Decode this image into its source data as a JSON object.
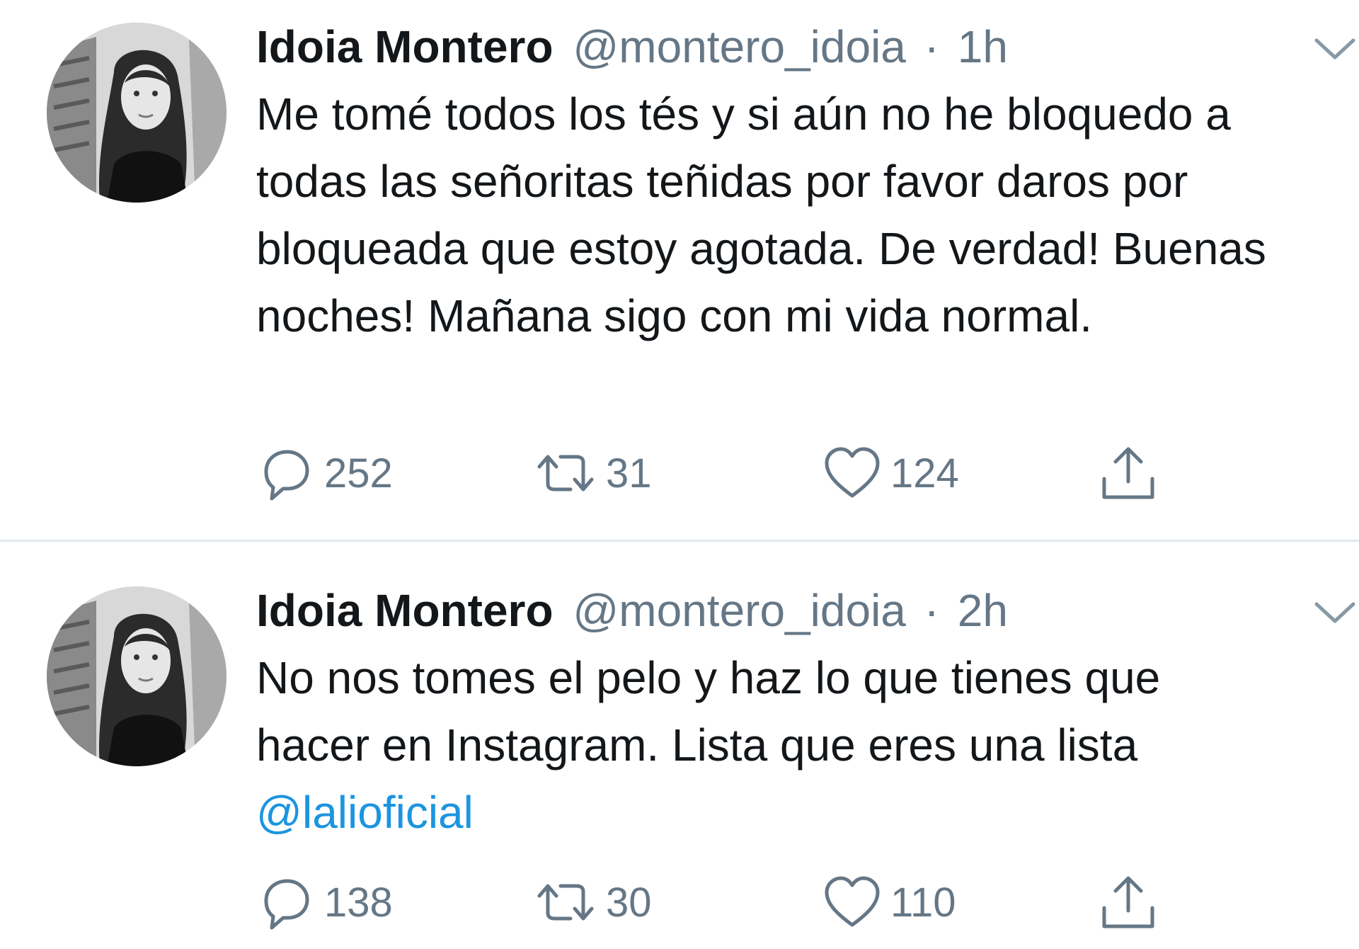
{
  "colors": {
    "text": "#14171a",
    "secondary": "#657786",
    "link": "#1b95e0",
    "divider": "#e1e8ed"
  },
  "tweets": [
    {
      "display_name": "Idoia Montero",
      "handle": "@montero_idoia",
      "separator": "·",
      "time": "1h",
      "text": "Me tomé todos los tés y si aún no he bloquedo a todas las señoritas teñidas por favor daros por bloqueada que estoy agotada. De verdad! Buenas noches! Mañana sigo con mi vida normal.",
      "mention": "",
      "replies": "252",
      "retweets": "31",
      "likes": "124",
      "icons": [
        "avatar",
        "chevron-down-icon",
        "reply-icon",
        "retweet-icon",
        "heart-icon",
        "share-icon"
      ]
    },
    {
      "display_name": "Idoia Montero",
      "handle": "@montero_idoia",
      "separator": "·",
      "time": "2h",
      "text": "No nos tomes el pelo y haz lo que tienes que hacer en Instagram. Lista que eres una lista ",
      "mention": "@lalioficial",
      "replies": "138",
      "retweets": "30",
      "likes": "110",
      "icons": [
        "avatar",
        "chevron-down-icon",
        "reply-icon",
        "retweet-icon",
        "heart-icon",
        "share-icon"
      ]
    }
  ]
}
